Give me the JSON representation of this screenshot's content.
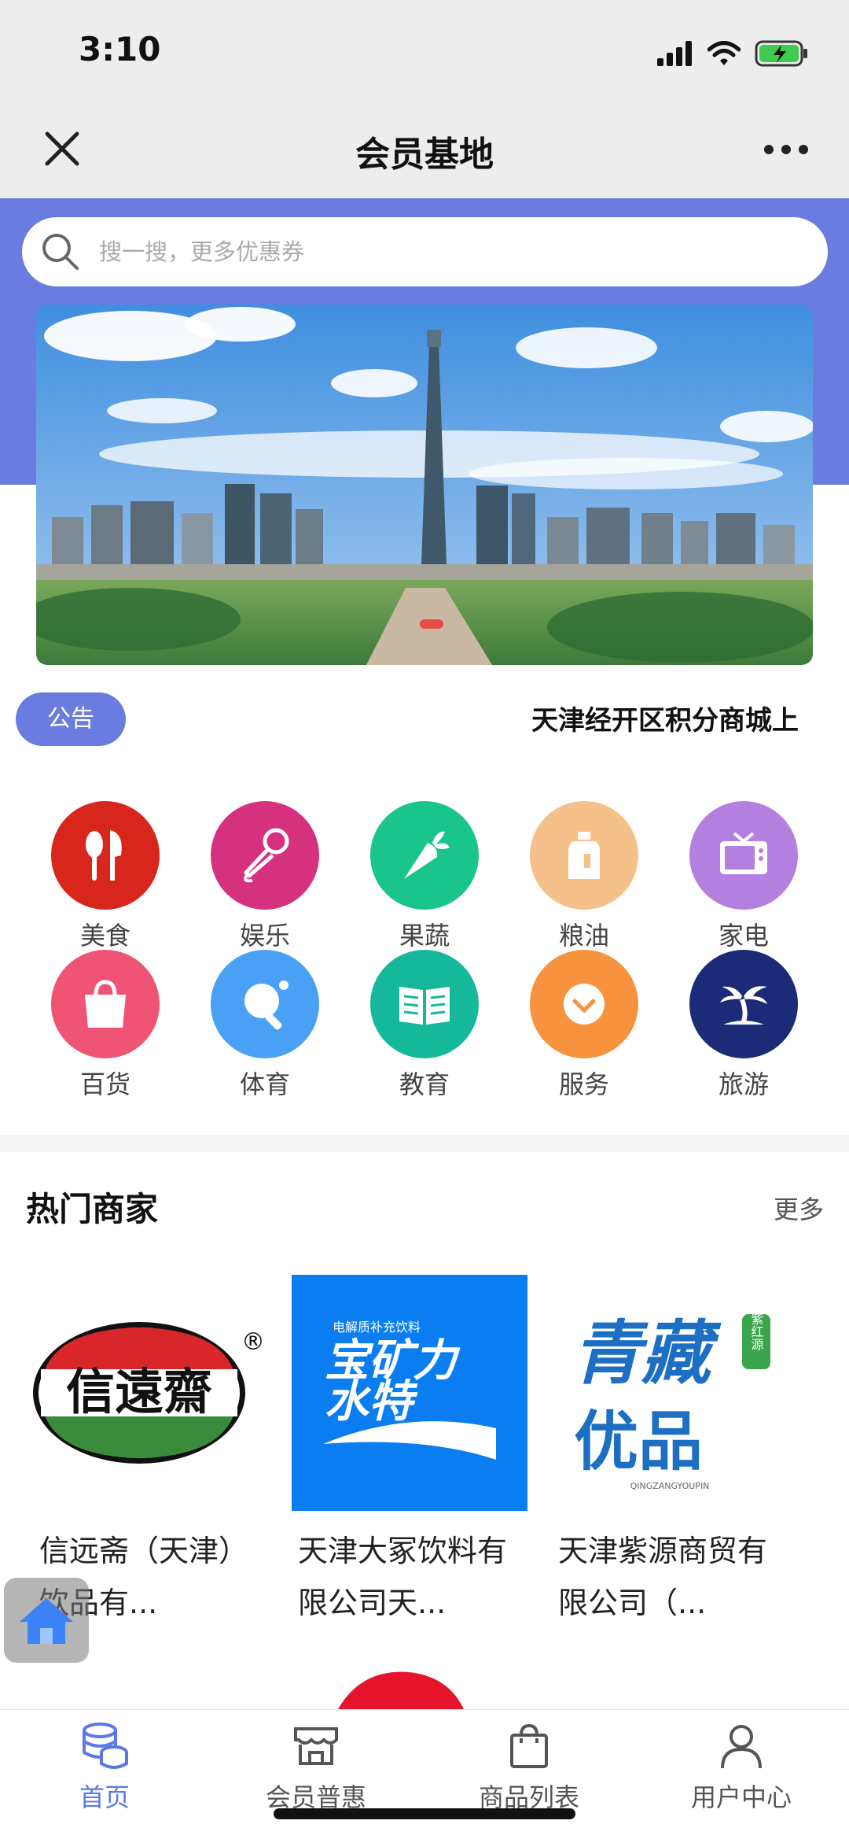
{
  "status_bar": {
    "time": "3:10"
  },
  "nav": {
    "title": "会员基地"
  },
  "search": {
    "placeholder": "搜一搜，更多优惠券"
  },
  "notice": {
    "badge": "公告",
    "text": "天津经开区积分商城上"
  },
  "categories": [
    {
      "label": "美食",
      "icon": "utensils-icon",
      "color": "#d9261c"
    },
    {
      "label": "娱乐",
      "icon": "microphone-icon",
      "color": "#d6317f"
    },
    {
      "label": "果蔬",
      "icon": "carrot-icon",
      "color": "#19c58c"
    },
    {
      "label": "粮油",
      "icon": "oil-bottle-icon",
      "color": "#f6c08a"
    },
    {
      "label": "家电",
      "icon": "tv-icon",
      "color": "#b480e0"
    },
    {
      "label": "百货",
      "icon": "shopping-bag-icon",
      "color": "#f05475"
    },
    {
      "label": "体育",
      "icon": "ping-pong-icon",
      "color": "#4aa0f5"
    },
    {
      "label": "教育",
      "icon": "book-icon",
      "color": "#16b89b"
    },
    {
      "label": "服务",
      "icon": "heart-hand-icon",
      "color": "#f7923f"
    },
    {
      "label": "旅游",
      "icon": "palm-tree-icon",
      "color": "#1c2b77"
    }
  ],
  "hot_merchants": {
    "title": "热门商家",
    "more": "更多",
    "items": [
      {
        "name": "信远斋（天津）饮品有...",
        "logo_text": "信遠齋",
        "logo_mark": "®"
      },
      {
        "name": "天津大冢饮料有限公司天...",
        "logo_small": "电解质补充饮料",
        "logo_line1": "宝矿力",
        "logo_line2": "水特"
      },
      {
        "name": "天津紫源商贸有限公司（...",
        "logo_line1": "青藏",
        "logo_line2": "优品",
        "logo_seal": "紫红源",
        "logo_caption": "QINGZANGYOUPIN"
      }
    ]
  },
  "tabs": [
    {
      "label": "首页",
      "icon": "home-database-icon"
    },
    {
      "label": "会员普惠",
      "icon": "store-icon"
    },
    {
      "label": "商品列表",
      "icon": "bag-icon"
    },
    {
      "label": "用户中心",
      "icon": "user-icon"
    }
  ],
  "colors": {
    "accent": "#6a7ce0",
    "tab_active": "#5a78e6"
  }
}
